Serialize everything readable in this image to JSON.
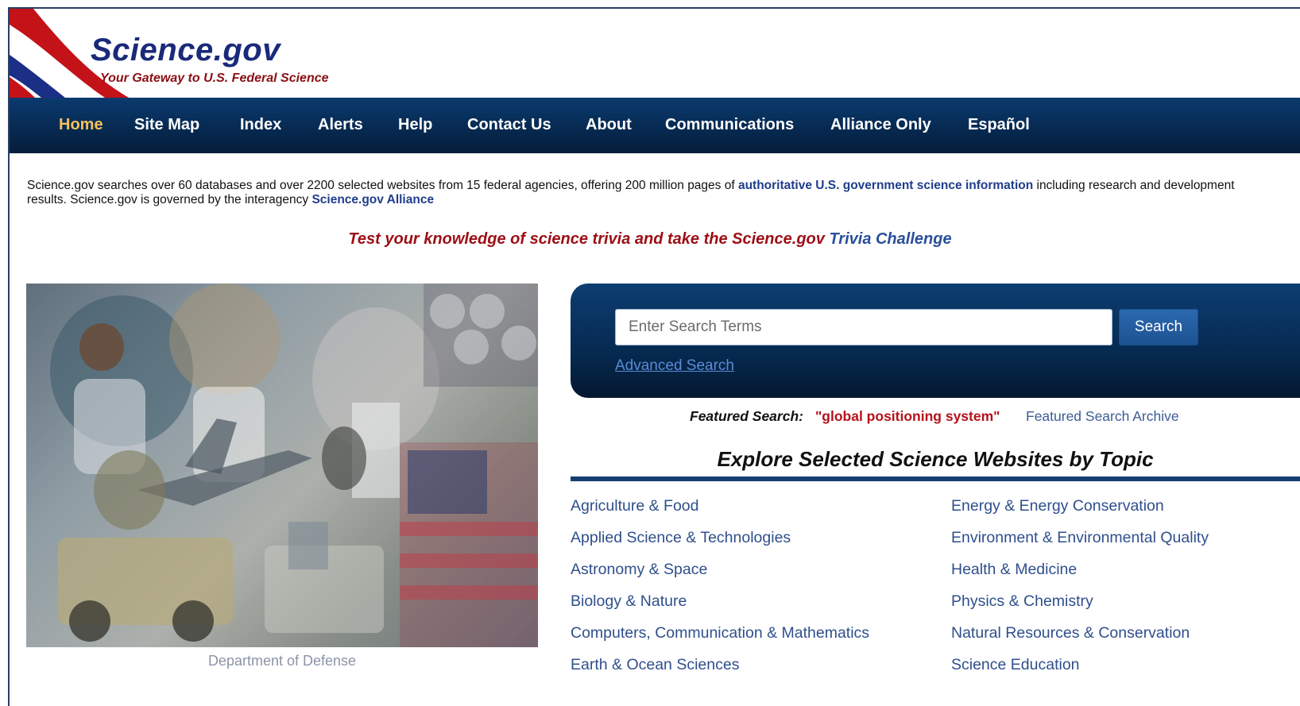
{
  "header": {
    "title": "Science.gov",
    "tagline": "Your Gateway to U.S. Federal Science"
  },
  "nav": {
    "items": [
      {
        "label": "Home",
        "active": true
      },
      {
        "label": "Site Map"
      },
      {
        "label": "Index"
      },
      {
        "label": "Alerts"
      },
      {
        "label": "Help"
      },
      {
        "label": "Contact Us"
      },
      {
        "label": "About"
      },
      {
        "label": "Communications"
      },
      {
        "label": "Alliance Only"
      },
      {
        "label": "Español"
      }
    ]
  },
  "intro": {
    "text_before": "Science.gov searches over 60 databases and over 2200 selected websites from 15 federal agencies, offering 200 million pages of ",
    "link1": "authoritative U.S. government science information",
    "text_middle": " including research and development results. Science.gov is governed by the interagency ",
    "link2": "Science.gov Alliance"
  },
  "trivia": {
    "text": "Test your knowledge of science trivia and take the Science.gov",
    "link": "Trivia Challenge"
  },
  "collage": {
    "caption": "Department of Defense"
  },
  "search": {
    "placeholder": "Enter Search Terms",
    "button_label": "Search",
    "advanced_label": "Advanced Search"
  },
  "featured": {
    "label": "Featured Search:",
    "term": "\"global positioning system\"",
    "archive": "Featured Search Archive"
  },
  "explore": {
    "heading": "Explore Selected Science Websites by Topic",
    "left_topics": [
      "Agriculture & Food",
      "Applied Science & Technologies",
      "Astronomy & Space",
      "Biology & Nature",
      "Computers, Communication & Mathematics",
      "Earth & Ocean Sciences"
    ],
    "right_topics": [
      "Energy & Energy Conservation",
      "Environment & Environmental Quality",
      "Health & Medicine",
      "Physics & Chemistry",
      "Natural Resources & Conservation",
      "Science Education"
    ]
  },
  "colors": {
    "nav_bg": "#072a52",
    "nav_active": "#f5c15a",
    "link_blue": "#2f4f8c",
    "brand_red": "#9c0e14"
  }
}
